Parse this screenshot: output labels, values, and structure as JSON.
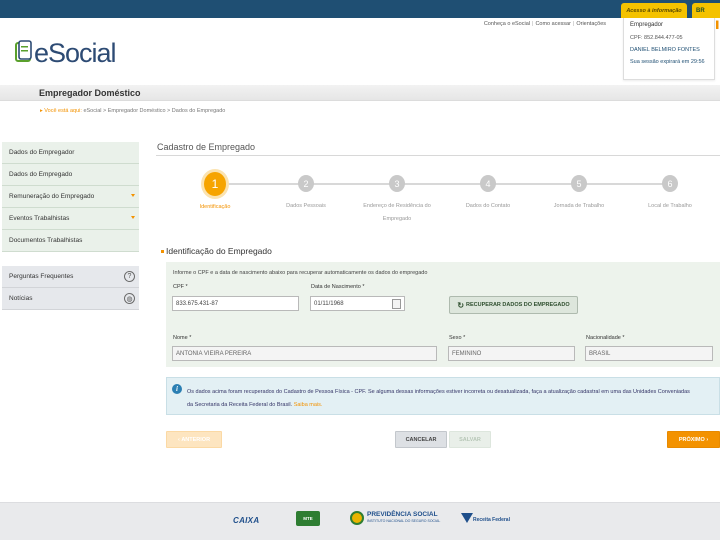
{
  "top_bar": {
    "access_tab": "Acesso à informação",
    "br_tab": "BR"
  },
  "brand": {
    "name": "eSocial"
  },
  "top_links": [
    "Conheça o eSocial",
    "Como acessar",
    "Orientações"
  ],
  "user": {
    "profile": "Empregador",
    "cpf": "CPF: 852.844.477-05",
    "name": "DANIEL BELMIRO FONTES",
    "session": "Sua sessão expirará em 29:56"
  },
  "page_title": "Empregador Doméstico",
  "breadcrumb": {
    "prefix": "Você está aqui:",
    "path": "eSocial > Empregador Doméstico > Dados do Empregado"
  },
  "sidebar": {
    "items": [
      {
        "label": "Dados do Empregador",
        "arrow": false
      },
      {
        "label": "Dados do Empregado",
        "arrow": false
      },
      {
        "label": "Remuneração do Empregado",
        "arrow": true
      },
      {
        "label": "Eventos Trabalhistas",
        "arrow": true
      },
      {
        "label": "Documentos Trabalhistas",
        "arrow": false
      }
    ],
    "help_items": [
      {
        "label": "Perguntas Frequentes",
        "icon": "question-icon"
      },
      {
        "label": "Notícias",
        "icon": "globe-icon"
      }
    ]
  },
  "section_title": "Cadastro de Empregado",
  "steps": [
    {
      "number": "1",
      "label": "Identificação",
      "active": true
    },
    {
      "number": "2",
      "label": "Dados Pessoais",
      "active": false
    },
    {
      "number": "3",
      "label": "Endereço de Residência do Empregado",
      "active": false
    },
    {
      "number": "4",
      "label": "Dados do Contato",
      "active": false
    },
    {
      "number": "5",
      "label": "Jornada de Trabalho",
      "active": false
    },
    {
      "number": "6",
      "label": "Local de Trabalho",
      "active": false
    }
  ],
  "subsection_title": "Identificação do Empregado",
  "form": {
    "hint": "Informe o CPF e a data de nascimento abaixo para recuperar automaticamente os dados do empregado",
    "cpf_label": "CPF *",
    "cpf_value": "833.675.431-87",
    "birth_label": "Data de Nascimento *",
    "birth_value": "01/11/1968",
    "recover_button": "RECUPERAR DADOS DO EMPREGADO",
    "name_label": "Nome *",
    "name_value": "ANTONIA VIEIRA PEREIRA",
    "sex_label": "Sexo *",
    "sex_value": "FEMININO",
    "nationality_label": "Nacionalidade *",
    "nationality_value": "BRASIL"
  },
  "info": {
    "text": "Os dados acima foram recuperados do Cadastro de Pessoa Física - CPF. Se alguma dessas informações estiver incorreta ou desatualizada, faça a atualização cadastral em uma das Unidades Conveniadas da Secretaria da Receita Federal do Brasil.",
    "link": "Saiba mais."
  },
  "buttons": {
    "previous": "ANTERIOR",
    "cancel": "CANCELAR",
    "save": "SALVAR",
    "next": "PRÓXIMO"
  },
  "footer": {
    "caixa": "CAIXA",
    "mte": "MTE",
    "previdencia": "PREVIDÊNCIA SOCIAL",
    "previdencia_sub": "INSTITUTO NACIONAL DO SEGURO SOCIAL",
    "receita": "Receita Federal"
  },
  "colors": {
    "accent": "#f39200",
    "navy": "#1f4f73",
    "panel_green": "#edf3ec",
    "info_blue": "#e3f0f4"
  }
}
